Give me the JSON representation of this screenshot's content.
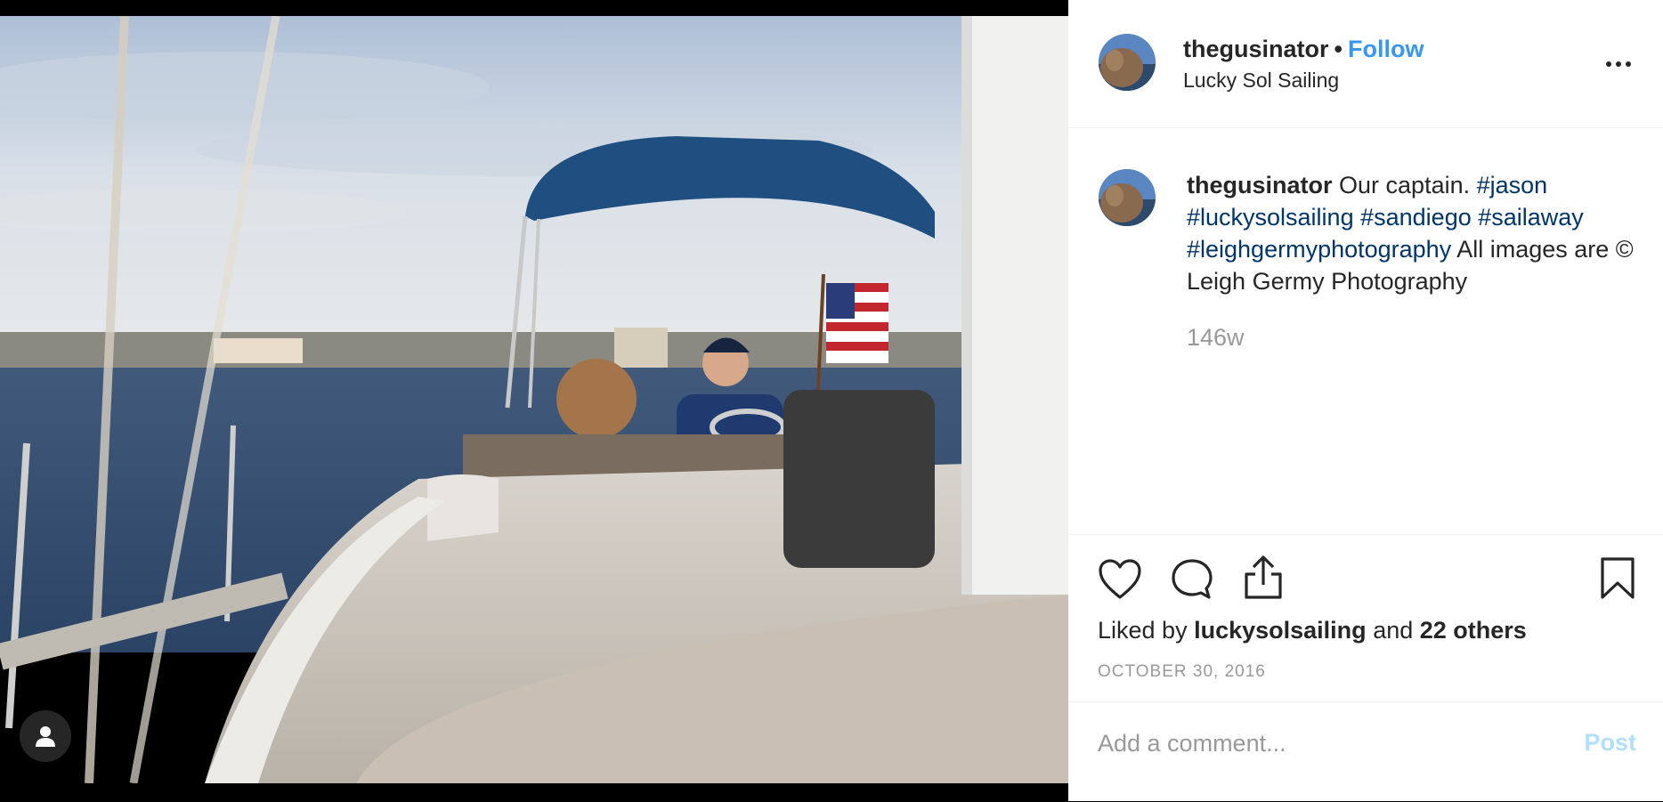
{
  "post": {
    "username": "thegusinator",
    "separator": "•",
    "follow_label": "Follow",
    "location": "Lucky Sol Sailing",
    "more_icon": "more-options-icon"
  },
  "caption": {
    "username": "thegusinator",
    "text_1": "Our captain.",
    "tags": [
      "#jason",
      "#luckysolsailing",
      "#sandiego",
      "#sailaway",
      "#leighgermyphotography"
    ],
    "text_2": "All images are © Leigh Germy Photography",
    "time_ago": "146w"
  },
  "actions": {
    "like_icon": "heart-icon",
    "comment_icon": "comment-bubble-icon",
    "share_icon": "share-icon",
    "save_icon": "bookmark-icon"
  },
  "likes": {
    "prefix": "Liked by",
    "user": "luckysolsailing",
    "middle": "and",
    "others": "22 others"
  },
  "date": "OCTOBER 30, 2016",
  "comment_box": {
    "placeholder": "Add a comment...",
    "post_label": "Post"
  },
  "colors": {
    "link": "#3897f0",
    "hashtag": "#003569",
    "muted": "#999999",
    "post_disabled": "#b2dffc"
  }
}
